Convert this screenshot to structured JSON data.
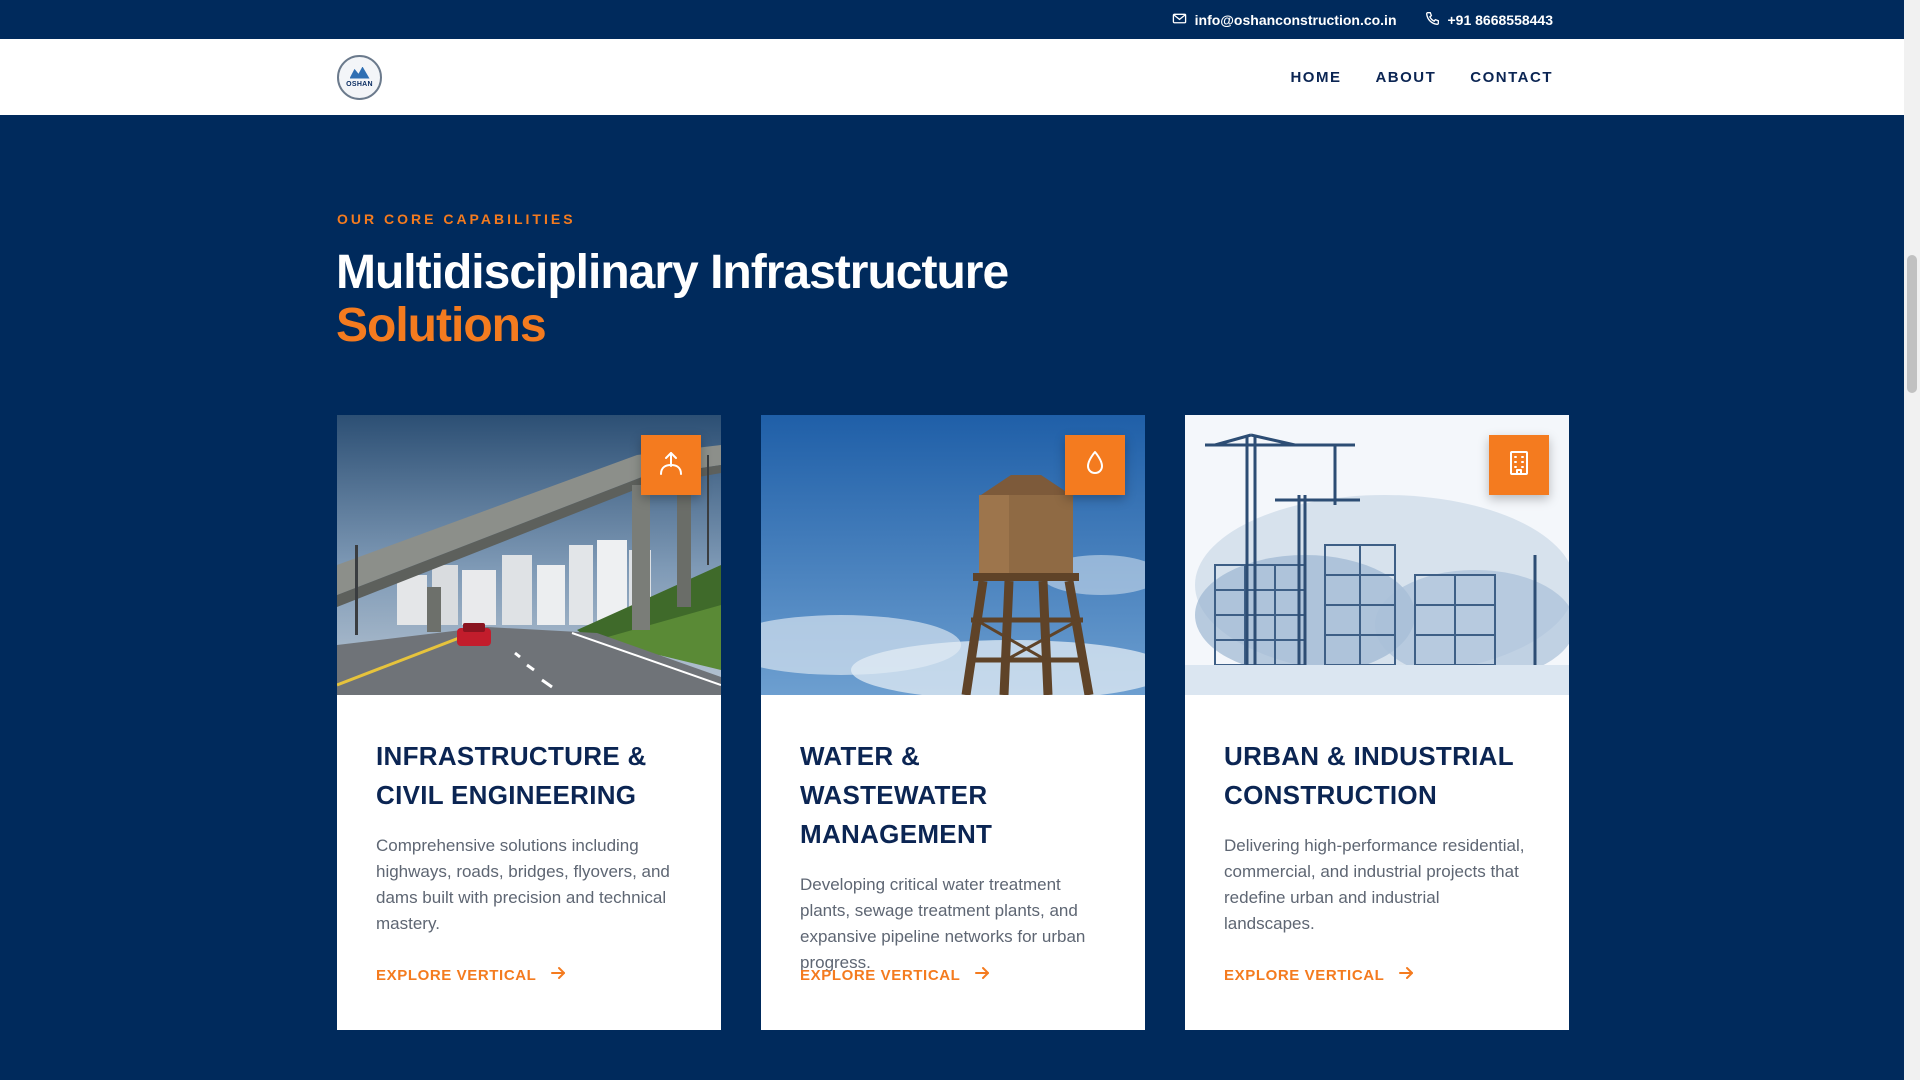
{
  "topbar": {
    "email": "info@oshanconstruction.co.in",
    "phone": "+91 8668558443",
    "email_icon": "mail-icon",
    "phone_icon": "phone-icon"
  },
  "navbar": {
    "logo_text": "OSHAN",
    "items": [
      {
        "label": "HOME"
      },
      {
        "label": "ABOUT"
      },
      {
        "label": "CONTACT"
      }
    ]
  },
  "section": {
    "eyebrow": "OUR CORE CAPABILITIES",
    "headline_line1": "Multidisciplinary Infrastructure",
    "headline_line2": "Solutions"
  },
  "cards": [
    {
      "title_line1": "INFRASTRUCTURE &",
      "title_line2": "CIVIL ENGINEERING",
      "description": "Comprehensive solutions including highways, roads, bridges, flyovers, and dams built with precision and technical mastery.",
      "link": "EXPLORE VERTICAL",
      "icon": "bridge-icon"
    },
    {
      "title_line1": "WATER & WASTEWATER",
      "title_line2": "MANAGEMENT",
      "description": "Developing critical water treatment plants, sewage treatment plants, and expansive pipeline networks for urban progress.",
      "link": "EXPLORE VERTICAL",
      "icon": "droplet-icon"
    },
    {
      "title_line1": "URBAN & INDUSTRIAL",
      "title_line2": "CONSTRUCTION",
      "description": "Delivering high-performance residential, commercial, and industrial projects that redefine urban and industrial landscapes.",
      "link": "EXPLORE VERTICAL",
      "icon": "building-icon"
    }
  ],
  "colors": {
    "navy": "#002a5c",
    "accent": "#f47b1f",
    "title": "#0b2553",
    "body": "#5e6673"
  }
}
